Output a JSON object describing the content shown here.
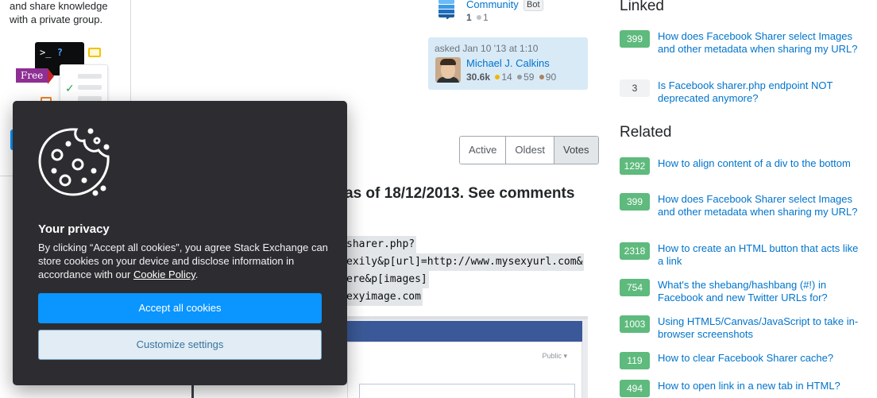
{
  "promo": {
    "text": "and share knowledge with a private group.",
    "free_label": "Free",
    "terminal_prompt": ">_",
    "terminal_q": "?"
  },
  "community": {
    "name": "Community",
    "badge": "Bot",
    "reputation": "1",
    "bronze": "1"
  },
  "asked": {
    "label": "asked Jan 10 '13 at 1:10",
    "user_name": "Michael J. Calkins",
    "reputation": "30.6k",
    "gold": "14",
    "silver": "59",
    "bronze": "90"
  },
  "sort": {
    "options": [
      "Active",
      "Oldest",
      "Votes"
    ],
    "selected": "Votes"
  },
  "answer": {
    "heading": "as of 18/12/2013. See comments",
    "code_lines": [
      "sharer.php?",
      "exily&p[url]=http://www.mysexyurl.com&",
      "ere&p[images]",
      "exyimage.com"
    ],
    "screenshot_public": "Public ▾"
  },
  "linked": {
    "title": "Linked",
    "items": [
      {
        "votes": "399",
        "text": "How does Facebook Sharer select Images and other metadata when sharing my URL?",
        "accepted": true
      },
      {
        "votes": "3",
        "text": "Is Facebook sharer.php endpoint NOT deprecated anymore?",
        "accepted": false
      }
    ]
  },
  "related": {
    "title": "Related",
    "items": [
      {
        "votes": "1292",
        "text": "How to align content of a div to the bottom"
      },
      {
        "votes": "399",
        "text": "How does Facebook Sharer select Images and other metadata when sharing my URL?"
      },
      {
        "votes": "2318",
        "text": "How to create an HTML button that acts like a link"
      },
      {
        "votes": "754",
        "text": "What's the shebang/hashbang (#!) in Facebook and new Twitter URLs for?"
      },
      {
        "votes": "1003",
        "text": "Using HTML5/Canvas/JavaScript to take in-browser screenshots"
      },
      {
        "votes": "119",
        "text": "How to clear Facebook Sharer cache?"
      },
      {
        "votes": "494",
        "text": "How to open link in a new tab in HTML?"
      }
    ]
  },
  "cookie": {
    "title": "Your privacy",
    "body_before": "By clicking “Accept all cookies”, you agree Stack Exchange can store cookies on your device and disclose information in accordance with our ",
    "policy_link": "Cookie Policy",
    "body_after": ".",
    "accept_label": "Accept all cookies",
    "customize_label": "Customize settings"
  },
  "colors": {
    "accent": "#0a95ff",
    "link": "#0074cc",
    "vote_accepted": "#5eba7d",
    "dialog_bg": "#2d2d31",
    "gold": "#f1b600",
    "silver": "#9a9c9f",
    "bronze": "#ab825f"
  }
}
